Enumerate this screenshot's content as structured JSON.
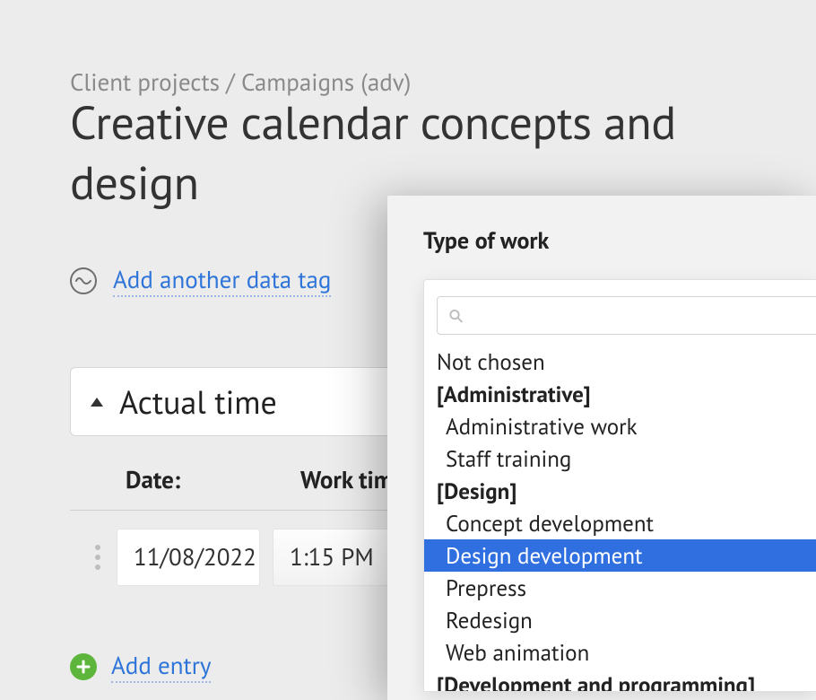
{
  "breadcrumb": "Client projects / Campaigns (adv)",
  "page_title": "Creative calendar concepts and design",
  "add_tag_label": "Add another data tag",
  "panel_title": "Actual time",
  "table": {
    "headers": {
      "date": "Date:",
      "time": "Work time"
    },
    "row": {
      "date": "11/08/2022",
      "time": "1:15 PM"
    }
  },
  "add_entry_label": "Add entry",
  "popup": {
    "title": "Type of work",
    "search_placeholder": "",
    "options": [
      {
        "label": "Not chosen",
        "type": "item"
      },
      {
        "label": "[Administrative]",
        "type": "group"
      },
      {
        "label": "Administrative work",
        "type": "child"
      },
      {
        "label": "Staff training",
        "type": "child"
      },
      {
        "label": "[Design]",
        "type": "group"
      },
      {
        "label": "Concept development",
        "type": "child"
      },
      {
        "label": "Design development",
        "type": "child",
        "selected": true
      },
      {
        "label": "Prepress",
        "type": "child"
      },
      {
        "label": "Redesign",
        "type": "child"
      },
      {
        "label": "Web animation",
        "type": "child"
      },
      {
        "label": "[Development and programming]",
        "type": "group"
      }
    ]
  }
}
